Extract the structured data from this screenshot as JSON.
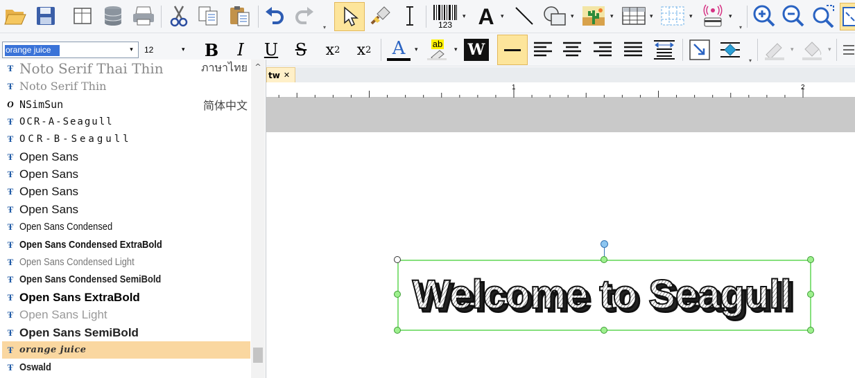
{
  "toolbar_top": {
    "icons": [
      "open-folder-icon",
      "save-icon",
      "page-setup-icon",
      "database-icon",
      "print-icon",
      "cut-icon",
      "copy-icon",
      "paste-icon",
      "undo-icon",
      "redo-icon",
      "select-pointer-icon",
      "format-painter-icon",
      "text-cursor-icon",
      "barcode-icon",
      "text-tool-icon",
      "line-tool-icon",
      "shape-tool-icon",
      "picture-tool-icon",
      "table-tool-icon",
      "grid-tool-icon",
      "rfid-encoder-icon",
      "zoom-in-icon",
      "zoom-out-icon",
      "zoom-to-fit-icon",
      "fit-page-icon"
    ],
    "barcode_caption": "123",
    "text_tool_glyph": "A"
  },
  "toolbar_format": {
    "font_value": "orange juice",
    "size_value": "12",
    "bold_glyph": "B",
    "italic_glyph": "I",
    "underline_glyph": "U",
    "strike_glyph": "S",
    "subscript_base": "x",
    "subscript_index": "2",
    "superscript_base": "x",
    "superscript_index": "2",
    "font_color_glyph": "A",
    "highlight_glyph": "ab",
    "wordart_glyph": "W"
  },
  "font_list": {
    "items": [
      {
        "name": "Noto Serif Thai Thin",
        "icon": "truetype-icon",
        "sample": "ภาษาไทย",
        "style": "thin-serif"
      },
      {
        "name": "Noto Serif Thin",
        "icon": "truetype-icon",
        "sample": "",
        "style": "thin-serif-small"
      },
      {
        "name": "NSimSun",
        "icon": "opentype-icon",
        "sample": "简体中文",
        "style": "mono"
      },
      {
        "name": "OCR-A-Seagull",
        "icon": "truetype-icon",
        "sample": "",
        "style": "ocr"
      },
      {
        "name": "OCR-B-Seagull",
        "icon": "truetype-icon",
        "sample": "",
        "style": "ocr-wide"
      },
      {
        "name": "Open Sans",
        "icon": "truetype-icon",
        "sample": "",
        "style": "regular"
      },
      {
        "name": "Open Sans",
        "icon": "truetype-icon",
        "sample": "",
        "style": "regular"
      },
      {
        "name": "Open Sans",
        "icon": "truetype-icon",
        "sample": "",
        "style": "regular"
      },
      {
        "name": "Open Sans",
        "icon": "truetype-icon",
        "sample": "",
        "style": "regular"
      },
      {
        "name": "Open Sans Condensed",
        "icon": "truetype-icon",
        "sample": "",
        "style": "condensed"
      },
      {
        "name": "Open Sans Condensed ExtraBold",
        "icon": "truetype-icon",
        "sample": "",
        "style": "condensed-bold"
      },
      {
        "name": "Open Sans Condensed Light",
        "icon": "truetype-icon",
        "sample": "",
        "style": "condensed-light"
      },
      {
        "name": "Open Sans Condensed SemiBold",
        "icon": "truetype-icon",
        "sample": "",
        "style": "condensed-semibold"
      },
      {
        "name": "Open Sans ExtraBold",
        "icon": "truetype-icon",
        "sample": "",
        "style": "extrabold"
      },
      {
        "name": "Open Sans Light",
        "icon": "truetype-icon",
        "sample": "",
        "style": "light"
      },
      {
        "name": "Open Sans SemiBold",
        "icon": "truetype-icon",
        "sample": "",
        "style": "semibold"
      },
      {
        "name": "orange juice",
        "icon": "truetype-icon",
        "sample": "",
        "style": "decorative",
        "selected": true
      },
      {
        "name": "Oswald",
        "icon": "truetype-icon",
        "sample": "",
        "style": "condensed-semibold"
      }
    ]
  },
  "document": {
    "tab_label": "tw",
    "tab_close": "✕",
    "ruler_labels": [
      "1",
      "2"
    ],
    "textbox_text": "Welcome to Seagull"
  },
  "colors": {
    "selected_row": "#fad7a0",
    "selection_border": "#86e07d",
    "active_tool": "#fde59b",
    "toolbar_bg": "#f5f6f8"
  }
}
